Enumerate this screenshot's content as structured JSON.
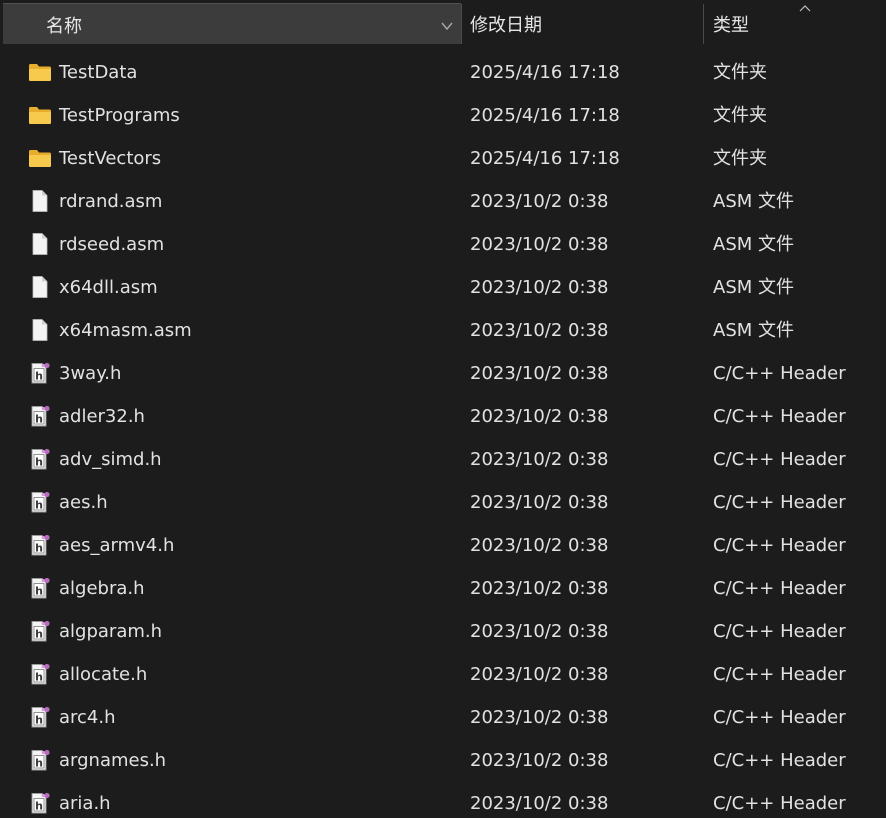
{
  "columns": {
    "name": "名称",
    "date_modified": "修改日期",
    "type": "类型"
  },
  "files": [
    {
      "name": "TestData",
      "date": "2025/4/16 17:18",
      "type": "文件夹",
      "icon": "folder-icon"
    },
    {
      "name": "TestPrograms",
      "date": "2025/4/16 17:18",
      "type": "文件夹",
      "icon": "folder-icon"
    },
    {
      "name": "TestVectors",
      "date": "2025/4/16 17:18",
      "type": "文件夹",
      "icon": "folder-icon"
    },
    {
      "name": "rdrand.asm",
      "date": "2023/10/2 0:38",
      "type": "ASM 文件",
      "icon": "file-icon"
    },
    {
      "name": "rdseed.asm",
      "date": "2023/10/2 0:38",
      "type": "ASM 文件",
      "icon": "file-icon"
    },
    {
      "name": "x64dll.asm",
      "date": "2023/10/2 0:38",
      "type": "ASM 文件",
      "icon": "file-icon"
    },
    {
      "name": "x64masm.asm",
      "date": "2023/10/2 0:38",
      "type": "ASM 文件",
      "icon": "file-icon"
    },
    {
      "name": "3way.h",
      "date": "2023/10/2 0:38",
      "type": "C/C++ Header",
      "icon": "header-file-icon"
    },
    {
      "name": "adler32.h",
      "date": "2023/10/2 0:38",
      "type": "C/C++ Header",
      "icon": "header-file-icon"
    },
    {
      "name": "adv_simd.h",
      "date": "2023/10/2 0:38",
      "type": "C/C++ Header",
      "icon": "header-file-icon"
    },
    {
      "name": "aes.h",
      "date": "2023/10/2 0:38",
      "type": "C/C++ Header",
      "icon": "header-file-icon"
    },
    {
      "name": "aes_armv4.h",
      "date": "2023/10/2 0:38",
      "type": "C/C++ Header",
      "icon": "header-file-icon"
    },
    {
      "name": "algebra.h",
      "date": "2023/10/2 0:38",
      "type": "C/C++ Header",
      "icon": "header-file-icon"
    },
    {
      "name": "algparam.h",
      "date": "2023/10/2 0:38",
      "type": "C/C++ Header",
      "icon": "header-file-icon"
    },
    {
      "name": "allocate.h",
      "date": "2023/10/2 0:38",
      "type": "C/C++ Header",
      "icon": "header-file-icon"
    },
    {
      "name": "arc4.h",
      "date": "2023/10/2 0:38",
      "type": "C/C++ Header",
      "icon": "header-file-icon"
    },
    {
      "name": "argnames.h",
      "date": "2023/10/2 0:38",
      "type": "C/C++ Header",
      "icon": "header-file-icon"
    },
    {
      "name": "aria.h",
      "date": "2023/10/2 0:38",
      "type": "C/C++ Header",
      "icon": "header-file-icon"
    }
  ],
  "colors": {
    "background": "#1c1c1c",
    "header_selected": "#3c3c3c",
    "text": "#e2e2e2",
    "folder": "#f3c14b",
    "header_icon_accent": "#c586c0"
  }
}
